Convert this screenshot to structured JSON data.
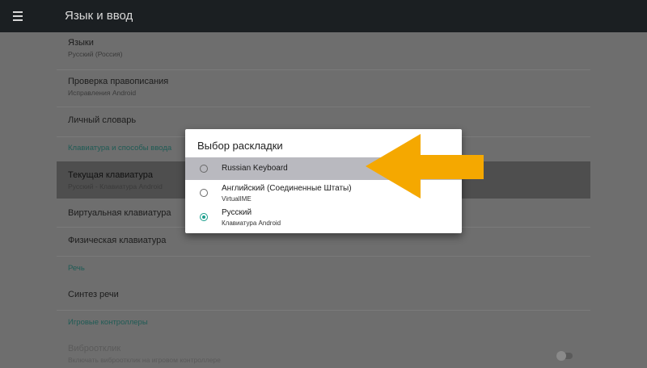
{
  "appbar": {
    "title": "Язык и ввод",
    "menu_icon": "hamburger-menu-icon"
  },
  "settings": {
    "languages": {
      "title": "Языки",
      "subtitle": "Русский (Россия)"
    },
    "spellcheck": {
      "title": "Проверка правописания",
      "subtitle": "Исправления Android"
    },
    "dictionary": {
      "title": "Личный словарь"
    },
    "section_keyboard": "Клавиатура и способы ввода",
    "current_keyboard": {
      "title": "Текущая клавиатура",
      "subtitle": "Русский - Клавиатура Android"
    },
    "virtual_keyboard": {
      "title": "Виртуальная клавиатура"
    },
    "physical_keyboard": {
      "title": "Физическая клавиатура"
    },
    "section_speech": "Речь",
    "tts": {
      "title": "Синтез речи"
    },
    "section_game": "Игровые контроллеры",
    "vibration": {
      "title": "Виброотклик",
      "subtitle": "Включать виброотклик на игровом контроллере"
    }
  },
  "dialog": {
    "title": "Выбор раскладки",
    "options": [
      {
        "label": "Russian Keyboard",
        "sublabel": "",
        "selected": false,
        "focused": true
      },
      {
        "label": "Английский (Соединенные Штаты)",
        "sublabel": "VirtualIME",
        "selected": false,
        "focused": false
      },
      {
        "label": "Русский",
        "sublabel": "Клавиатура Android",
        "selected": true,
        "focused": false
      }
    ]
  },
  "colors": {
    "accent": "#1a9e8c",
    "annotation_arrow": "#f5a800",
    "appbar": "#1b1f22"
  }
}
